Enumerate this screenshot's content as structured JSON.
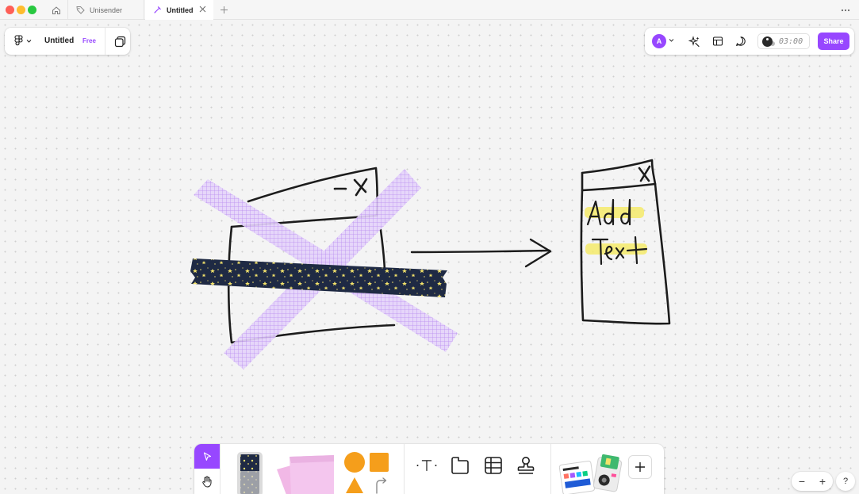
{
  "tabs": [
    {
      "label": "Unisender",
      "active": false
    },
    {
      "label": "Untitled",
      "active": true
    }
  ],
  "file": {
    "title": "Untitled",
    "plan_badge": "Free"
  },
  "header": {
    "avatar_initial": "A",
    "timer": "03:00",
    "share_label": "Share"
  },
  "canvas": {
    "note_handwriting": [
      "Add",
      "Text"
    ],
    "tape_colors": {
      "grid": "#c9a4f7",
      "stars": "#1e2740",
      "star": "#f3e26b"
    },
    "highlight_color": "#f5ea6a"
  },
  "icons": {
    "home": "home-icon",
    "unisender_tab": "tag-icon",
    "untitled_tab": "figjam-icon",
    "close": "close-icon",
    "new_tab": "plus-icon",
    "more": "more-icon",
    "main_menu": "figma-logo-icon",
    "pages": "pages-icon",
    "ai": "sparkle-icon",
    "widgets": "layout-icon",
    "comments": "comment-icon",
    "select": "cursor-icon",
    "hand": "hand-icon",
    "text": "text-icon",
    "section": "section-icon",
    "table": "table-icon",
    "stamp": "stamp-icon",
    "more_tools": "plus-icon"
  },
  "accent_color": "#9747ff",
  "zoom": {
    "minus": "−",
    "plus": "+"
  },
  "help_label": "?"
}
